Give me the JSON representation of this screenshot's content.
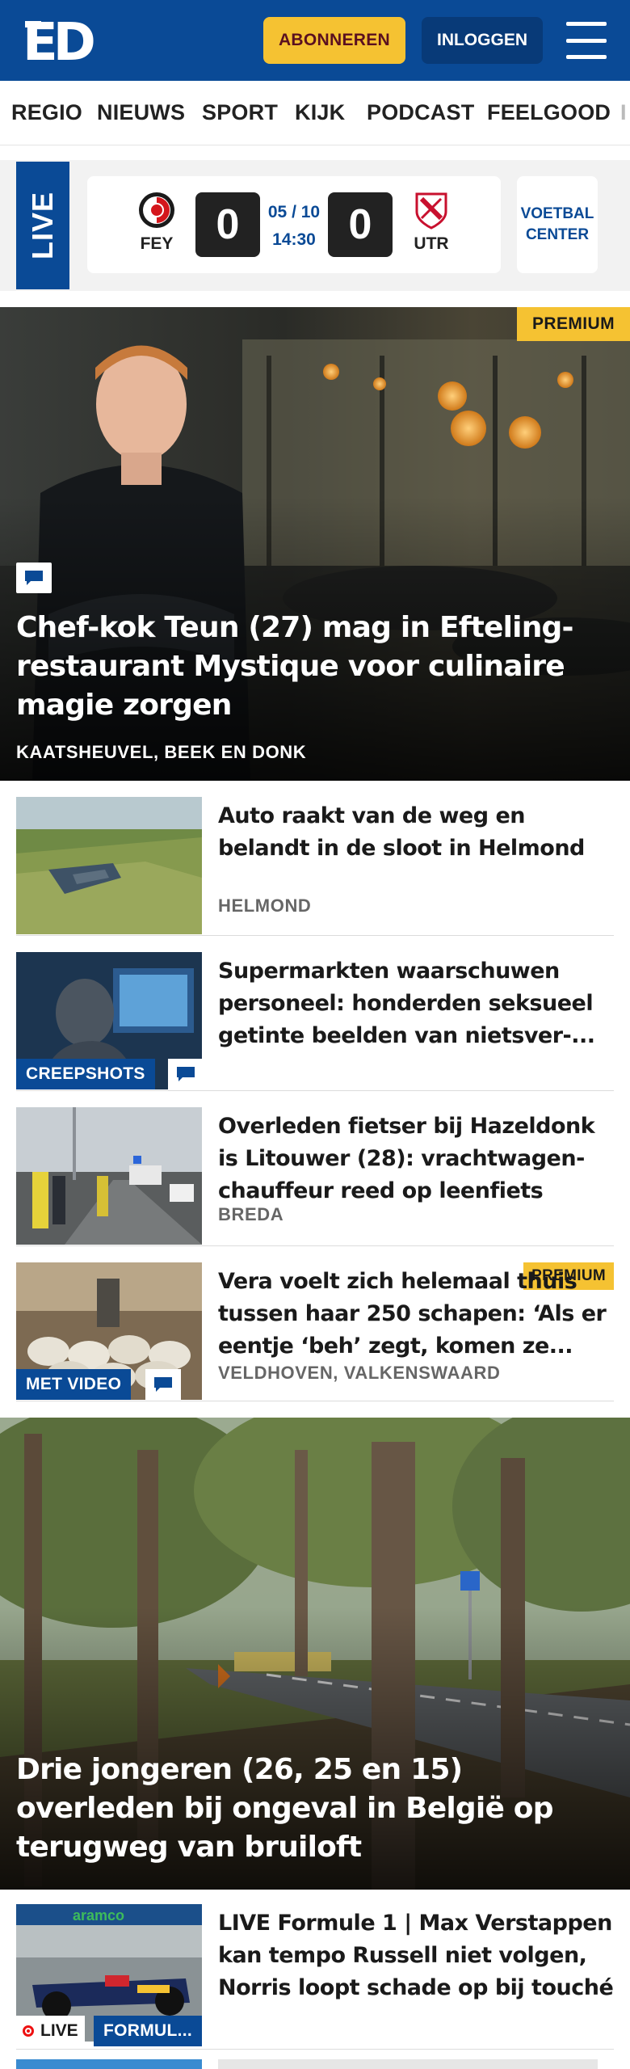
{
  "header": {
    "logo_text": "ED",
    "subscribe_label": "ABONNEREN",
    "login_label": "INLOGGEN",
    "brand_color": "#0a4a96",
    "accent_color": "#f5c232",
    "menu_icon": "hamburger-menu-icon"
  },
  "nav": {
    "items": [
      "REGIO",
      "NIEUWS",
      "SPORT",
      "KIJK",
      "PODCAST",
      "FEELGOOD",
      "I"
    ]
  },
  "live": {
    "tab_label": "LIVE",
    "home_team": "FEY",
    "away_team": "UTR",
    "home_score": "0",
    "away_score": "0",
    "date": "05 / 10",
    "time": "14:30",
    "center_label": "VOETBAL CENTER"
  },
  "hero1": {
    "premium_label": "PREMIUM",
    "title": "Chef-kok Teun (27) mag in Efteling-restaurant Mystique voor culinaire magie zorgen",
    "location": "KAATSHEUVEL, BEEK EN DONK",
    "icon": "comment-icon"
  },
  "articles": [
    {
      "title": "Auto raakt van de weg en belandt in de sloot in Helmond",
      "location": "HELMOND"
    },
    {
      "title": "Supermarkten waarschuwen personeel: honderden seksueel getinte beelden van nietsver-...",
      "location": "",
      "label": "CREEPSHOTS"
    },
    {
      "title": "Overleden fietser bij Hazeldonk is Litouwer (28): vrachtwagen-chauffeur reed op leenfiets",
      "location": "BREDA"
    },
    {
      "title": "Vera voelt zich helemaal thuis tussen haar 250 schapen: ‘Als er eentje ‘beh’ zegt, komen ze...",
      "location": "VELDHOVEN, VALKENSWAARD",
      "label": "MET VIDEO",
      "premium_label": "PREMIUM"
    }
  ],
  "hero2": {
    "title": "Drie jongeren (26, 25 en 15) overleden bij ongeval in België op terugweg van bruiloft"
  },
  "live_article": {
    "title": "LIVE Formule 1 | Max Verstappen kan tempo Russell niet volgen, Norris loopt schade op bij touché",
    "live_label": "LIVE",
    "category_label": "FORMUL...",
    "banner_text": "aramco"
  }
}
